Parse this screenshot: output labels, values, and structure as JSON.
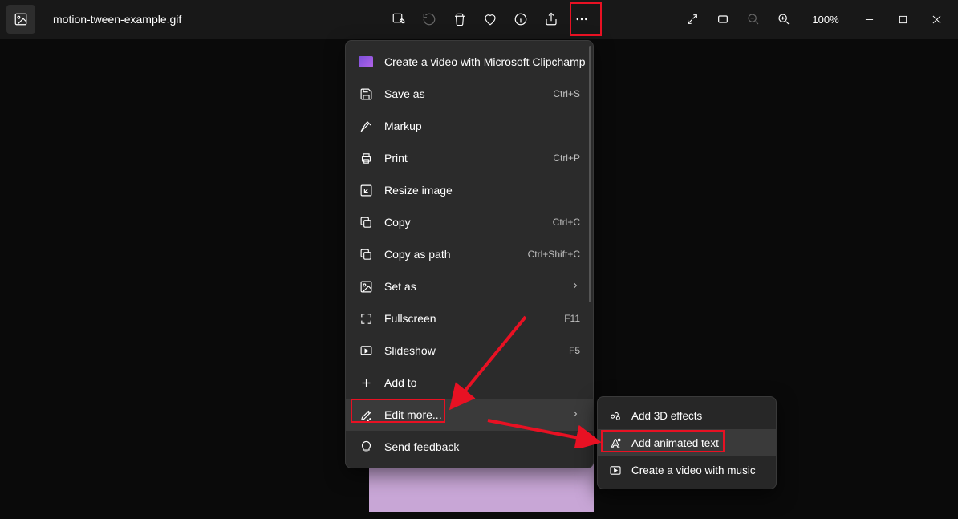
{
  "filename": "motion-tween-example.gif",
  "zoom": "100%",
  "menu": {
    "items": [
      {
        "icon": "clipchamp",
        "label": "Create a video with Microsoft Clipchamp",
        "shortcut": ""
      },
      {
        "icon": "save",
        "label": "Save as",
        "shortcut": "Ctrl+S"
      },
      {
        "icon": "markup",
        "label": "Markup",
        "shortcut": ""
      },
      {
        "icon": "print",
        "label": "Print",
        "shortcut": "Ctrl+P"
      },
      {
        "icon": "resize",
        "label": "Resize image",
        "shortcut": ""
      },
      {
        "icon": "copy",
        "label": "Copy",
        "shortcut": "Ctrl+C"
      },
      {
        "icon": "copypath",
        "label": "Copy as path",
        "shortcut": "Ctrl+Shift+C"
      },
      {
        "icon": "setas",
        "label": "Set as",
        "shortcut": "",
        "chev": true
      },
      {
        "icon": "fullscreen",
        "label": "Fullscreen",
        "shortcut": "F11"
      },
      {
        "icon": "slideshow",
        "label": "Slideshow",
        "shortcut": "F5"
      },
      {
        "icon": "addto",
        "label": "Add to",
        "shortcut": ""
      },
      {
        "icon": "editmore",
        "label": "Edit more...",
        "shortcut": "",
        "chev": true,
        "hover": true
      },
      {
        "icon": "feedback",
        "label": "Send feedback",
        "shortcut": ""
      }
    ]
  },
  "submenu": {
    "items": [
      {
        "icon": "effects3d",
        "label": "Add 3D effects"
      },
      {
        "icon": "animtext",
        "label": "Add animated text",
        "hover": true
      },
      {
        "icon": "videomusic",
        "label": "Create a video with music"
      }
    ]
  }
}
